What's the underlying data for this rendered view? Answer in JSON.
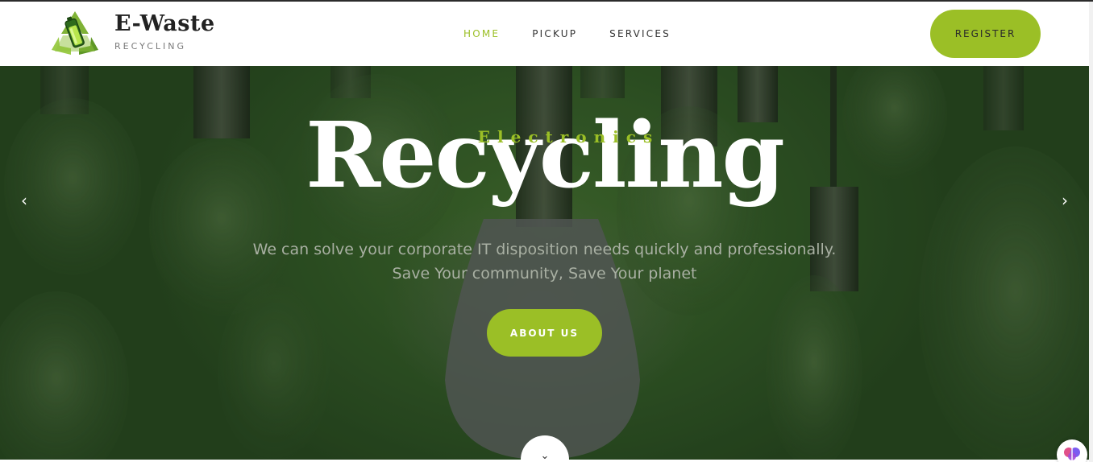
{
  "header": {
    "brand_name": "E-Waste",
    "brand_sub": "RECYCLING",
    "nav": [
      {
        "label": "HOME",
        "active": true
      },
      {
        "label": "PICKUP",
        "active": false
      },
      {
        "label": "SERVICES",
        "active": false
      }
    ],
    "register_label": "REGISTER"
  },
  "hero": {
    "eyebrow": "Electronics",
    "headline": "Recycling",
    "subtext_line1": "We can solve your corporate IT disposition needs quickly and professionally.",
    "subtext_line2": "Save Your community, Save Your planet",
    "cta_label": "ABOUT US",
    "prev_arrow": "‹",
    "next_arrow": "›",
    "scroll_down_glyph": "⌄"
  },
  "colors": {
    "accent": "#9bbf26",
    "hero_green": "#2f5623",
    "text_dark": "#2a2a2a",
    "subtext": "#a9b0a3"
  },
  "icons": {
    "logo": "recycle-battery-logo-icon",
    "prev": "chevron-left-icon",
    "next": "chevron-right-icon",
    "scroll": "chevron-down-icon",
    "badge": "brain-icon"
  }
}
